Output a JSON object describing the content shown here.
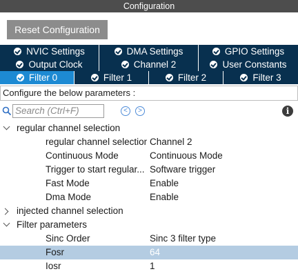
{
  "window": {
    "title": "Configuration"
  },
  "toolbar": {
    "reset_label": "Reset Configuration"
  },
  "tabs": {
    "row1": [
      {
        "label": "NVIC Settings",
        "icon": "check-circle-icon"
      },
      {
        "label": "DMA Settings",
        "icon": "check-circle-icon"
      },
      {
        "label": "GPIO Settings",
        "icon": "check-circle-icon"
      }
    ],
    "row2": [
      {
        "label": "Output Clock",
        "icon": "check-circle-icon"
      },
      {
        "label": "Channel 2",
        "icon": "check-circle-icon"
      },
      {
        "label": "User Constants",
        "icon": "check-circle-icon"
      }
    ],
    "row3": [
      {
        "label": "Filter 0",
        "icon": "check-circle-icon",
        "active": true
      },
      {
        "label": "Filter 1",
        "icon": "check-circle-icon"
      },
      {
        "label": "Filter 2",
        "icon": "check-circle-icon"
      },
      {
        "label": "Filter 3",
        "icon": "check-circle-icon"
      }
    ]
  },
  "hint": "Configure the below parameters :",
  "search": {
    "placeholder": "Search (Ctrl+F)",
    "icon": "search-icon"
  },
  "tree": {
    "regular": {
      "label": "regular channel selection",
      "expanded": true,
      "params": [
        {
          "name": "regular channel selection",
          "value": "Channel 2"
        },
        {
          "name": "Continuous Mode",
          "value": "Continuous Mode"
        },
        {
          "name": "Trigger to start regular...",
          "value": "Software trigger"
        },
        {
          "name": "Fast Mode",
          "value": "Enable"
        },
        {
          "name": "Dma Mode",
          "value": "Enable"
        }
      ]
    },
    "injected": {
      "label": "injected channel selection",
      "expanded": false
    },
    "filter": {
      "label": "Filter parameters",
      "expanded": true,
      "params": [
        {
          "name": "Sinc Order",
          "value": "Sinc 3 filter type"
        },
        {
          "name": "Fosr",
          "value": "64",
          "selected": true
        },
        {
          "name": "Iosr",
          "value": "1"
        }
      ]
    }
  },
  "colors": {
    "tab_bg": "#08304f",
    "tab_active": "#1d8ad3",
    "selected_row": "#b4cce2",
    "title_bar": "#4d4d4d"
  }
}
